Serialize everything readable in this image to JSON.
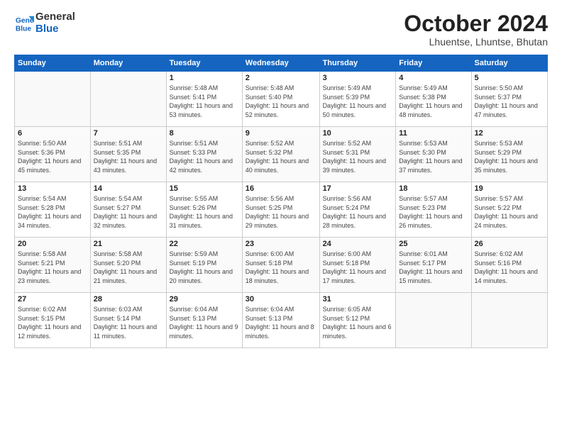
{
  "logo": {
    "line1": "General",
    "line2": "Blue"
  },
  "title": "October 2024",
  "subtitle": "Lhuentse, Lhuntse, Bhutan",
  "days_header": [
    "Sunday",
    "Monday",
    "Tuesday",
    "Wednesday",
    "Thursday",
    "Friday",
    "Saturday"
  ],
  "weeks": [
    [
      {
        "day": "",
        "info": ""
      },
      {
        "day": "",
        "info": ""
      },
      {
        "day": "1",
        "info": "Sunrise: 5:48 AM\nSunset: 5:41 PM\nDaylight: 11 hours and 53 minutes."
      },
      {
        "day": "2",
        "info": "Sunrise: 5:48 AM\nSunset: 5:40 PM\nDaylight: 11 hours and 52 minutes."
      },
      {
        "day": "3",
        "info": "Sunrise: 5:49 AM\nSunset: 5:39 PM\nDaylight: 11 hours and 50 minutes."
      },
      {
        "day": "4",
        "info": "Sunrise: 5:49 AM\nSunset: 5:38 PM\nDaylight: 11 hours and 48 minutes."
      },
      {
        "day": "5",
        "info": "Sunrise: 5:50 AM\nSunset: 5:37 PM\nDaylight: 11 hours and 47 minutes."
      }
    ],
    [
      {
        "day": "6",
        "info": "Sunrise: 5:50 AM\nSunset: 5:36 PM\nDaylight: 11 hours and 45 minutes."
      },
      {
        "day": "7",
        "info": "Sunrise: 5:51 AM\nSunset: 5:35 PM\nDaylight: 11 hours and 43 minutes."
      },
      {
        "day": "8",
        "info": "Sunrise: 5:51 AM\nSunset: 5:33 PM\nDaylight: 11 hours and 42 minutes."
      },
      {
        "day": "9",
        "info": "Sunrise: 5:52 AM\nSunset: 5:32 PM\nDaylight: 11 hours and 40 minutes."
      },
      {
        "day": "10",
        "info": "Sunrise: 5:52 AM\nSunset: 5:31 PM\nDaylight: 11 hours and 39 minutes."
      },
      {
        "day": "11",
        "info": "Sunrise: 5:53 AM\nSunset: 5:30 PM\nDaylight: 11 hours and 37 minutes."
      },
      {
        "day": "12",
        "info": "Sunrise: 5:53 AM\nSunset: 5:29 PM\nDaylight: 11 hours and 35 minutes."
      }
    ],
    [
      {
        "day": "13",
        "info": "Sunrise: 5:54 AM\nSunset: 5:28 PM\nDaylight: 11 hours and 34 minutes."
      },
      {
        "day": "14",
        "info": "Sunrise: 5:54 AM\nSunset: 5:27 PM\nDaylight: 11 hours and 32 minutes."
      },
      {
        "day": "15",
        "info": "Sunrise: 5:55 AM\nSunset: 5:26 PM\nDaylight: 11 hours and 31 minutes."
      },
      {
        "day": "16",
        "info": "Sunrise: 5:56 AM\nSunset: 5:25 PM\nDaylight: 11 hours and 29 minutes."
      },
      {
        "day": "17",
        "info": "Sunrise: 5:56 AM\nSunset: 5:24 PM\nDaylight: 11 hours and 28 minutes."
      },
      {
        "day": "18",
        "info": "Sunrise: 5:57 AM\nSunset: 5:23 PM\nDaylight: 11 hours and 26 minutes."
      },
      {
        "day": "19",
        "info": "Sunrise: 5:57 AM\nSunset: 5:22 PM\nDaylight: 11 hours and 24 minutes."
      }
    ],
    [
      {
        "day": "20",
        "info": "Sunrise: 5:58 AM\nSunset: 5:21 PM\nDaylight: 11 hours and 23 minutes."
      },
      {
        "day": "21",
        "info": "Sunrise: 5:58 AM\nSunset: 5:20 PM\nDaylight: 11 hours and 21 minutes."
      },
      {
        "day": "22",
        "info": "Sunrise: 5:59 AM\nSunset: 5:19 PM\nDaylight: 11 hours and 20 minutes."
      },
      {
        "day": "23",
        "info": "Sunrise: 6:00 AM\nSunset: 5:18 PM\nDaylight: 11 hours and 18 minutes."
      },
      {
        "day": "24",
        "info": "Sunrise: 6:00 AM\nSunset: 5:18 PM\nDaylight: 11 hours and 17 minutes."
      },
      {
        "day": "25",
        "info": "Sunrise: 6:01 AM\nSunset: 5:17 PM\nDaylight: 11 hours and 15 minutes."
      },
      {
        "day": "26",
        "info": "Sunrise: 6:02 AM\nSunset: 5:16 PM\nDaylight: 11 hours and 14 minutes."
      }
    ],
    [
      {
        "day": "27",
        "info": "Sunrise: 6:02 AM\nSunset: 5:15 PM\nDaylight: 11 hours and 12 minutes."
      },
      {
        "day": "28",
        "info": "Sunrise: 6:03 AM\nSunset: 5:14 PM\nDaylight: 11 hours and 11 minutes."
      },
      {
        "day": "29",
        "info": "Sunrise: 6:04 AM\nSunset: 5:13 PM\nDaylight: 11 hours and 9 minutes."
      },
      {
        "day": "30",
        "info": "Sunrise: 6:04 AM\nSunset: 5:13 PM\nDaylight: 11 hours and 8 minutes."
      },
      {
        "day": "31",
        "info": "Sunrise: 6:05 AM\nSunset: 5:12 PM\nDaylight: 11 hours and 6 minutes."
      },
      {
        "day": "",
        "info": ""
      },
      {
        "day": "",
        "info": ""
      }
    ]
  ]
}
